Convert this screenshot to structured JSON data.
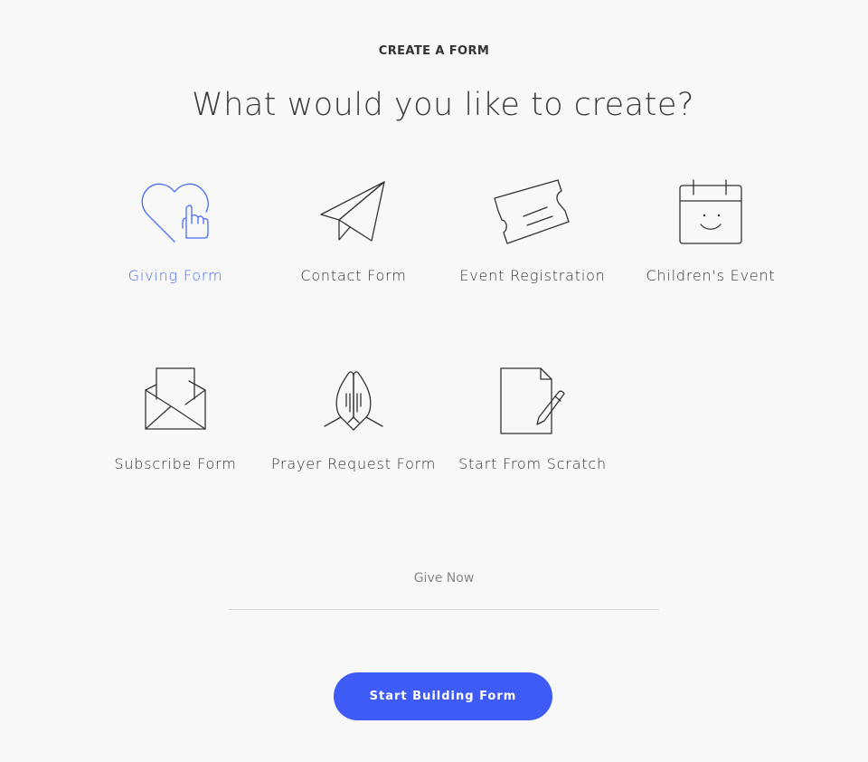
{
  "header": {
    "eyebrow": "CREATE A FORM",
    "title": "What would you like to create?"
  },
  "form_types": [
    {
      "label": "Giving Form",
      "icon": "heart-hand-icon",
      "selected": true
    },
    {
      "label": "Contact Form",
      "icon": "paper-plane-icon",
      "selected": false
    },
    {
      "label": "Event Registration",
      "icon": "ticket-icon",
      "selected": false
    },
    {
      "label": "Children's Event",
      "icon": "calendar-smiley-icon",
      "selected": false
    },
    {
      "label": "Subscribe Form",
      "icon": "envelope-open-icon",
      "selected": false
    },
    {
      "label": "Prayer Request Form",
      "icon": "praying-hands-icon",
      "selected": false
    },
    {
      "label": "Start From Scratch",
      "icon": "document-pencil-icon",
      "selected": false
    }
  ],
  "form_name": {
    "value": "",
    "placeholder": "Give Now"
  },
  "actions": {
    "start_label": "Start Building Form"
  },
  "colors": {
    "accent": "#3f5bf6",
    "selected_text": "#4a6cf7",
    "background": "#f8f8f8"
  }
}
